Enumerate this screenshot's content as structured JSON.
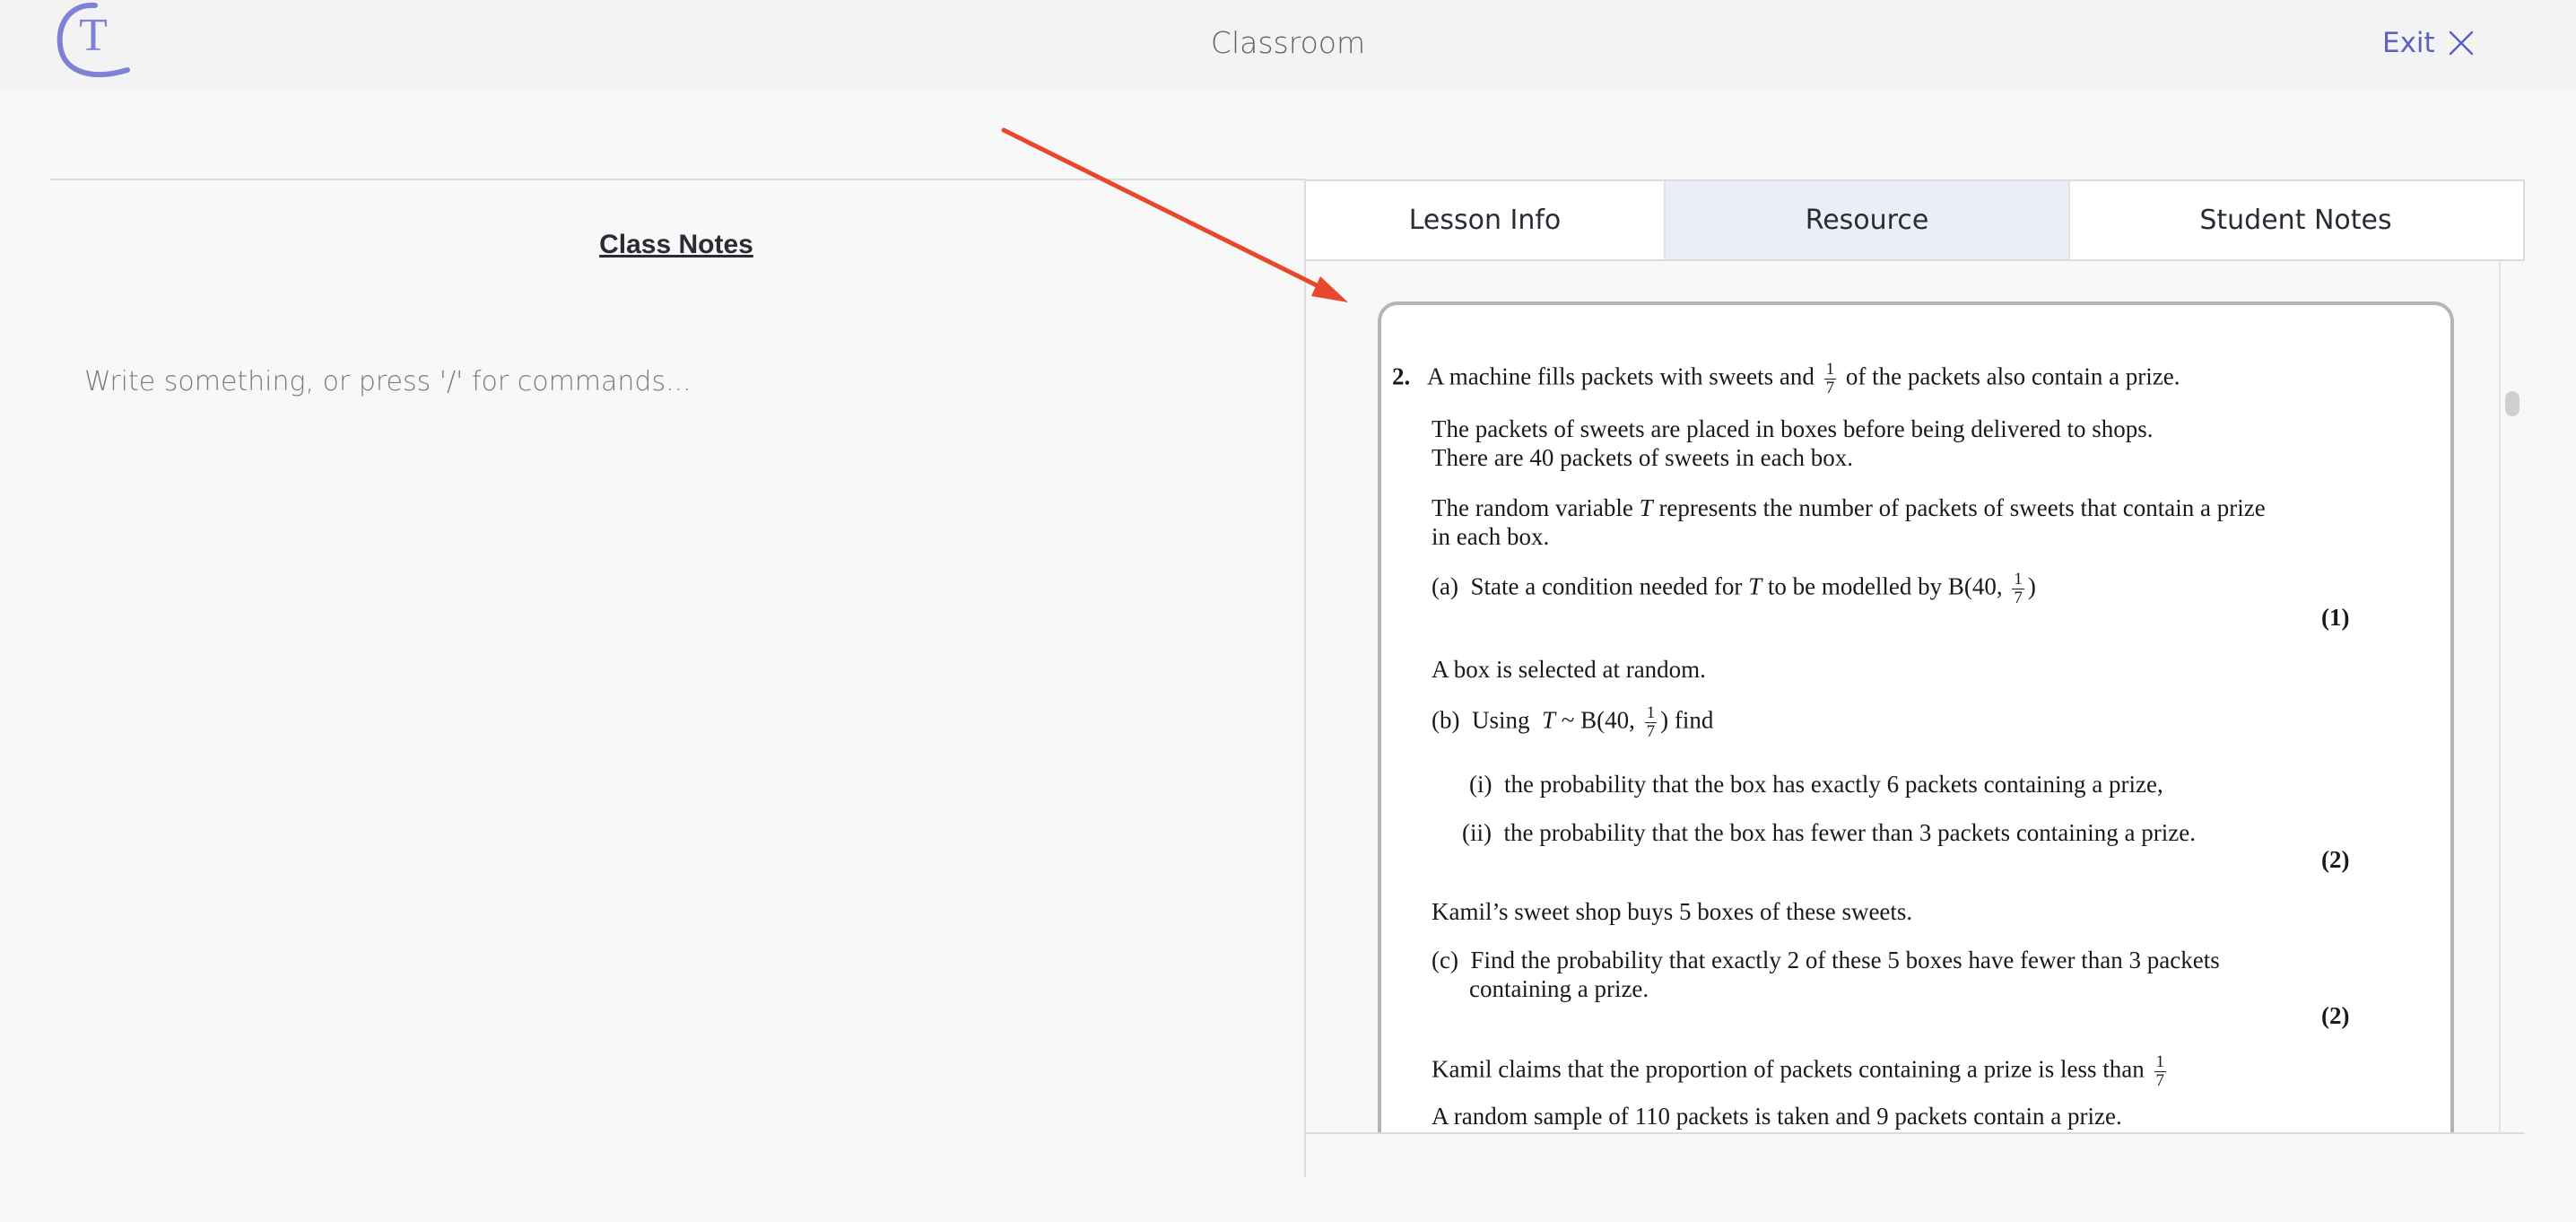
{
  "header": {
    "title": "Classroom",
    "exit_label": "Exit",
    "logo_letter": "T"
  },
  "left_pane": {
    "heading": "Class Notes",
    "editor_placeholder": "Write something, or press '/' for commands..."
  },
  "tabs": [
    {
      "label": "Lesson Info",
      "active": false
    },
    {
      "label": "Resource",
      "active": true
    },
    {
      "label": "Student Notes",
      "active": false
    }
  ],
  "resource": {
    "question_number": "2.",
    "fraction": {
      "numerator": "1",
      "denominator": "7"
    },
    "intro": {
      "before_frac": "A machine fills packets with sweets and",
      "after_frac": "of the packets also contain a prize."
    },
    "para2_line1": "The packets of sweets are placed in boxes before being delivered to shops.",
    "para2_line2": "There are 40 packets of sweets in each box.",
    "para3_pre": "The random variable",
    "var_T": "T",
    "para3_post": "represents the number of packets of sweets that contain a prize",
    "para3_line2": "in each box.",
    "part_a": {
      "label": "(a)",
      "pre": "State a condition needed for",
      "mid": "to be modelled by B(40,",
      "close": ")",
      "marks": "(1)"
    },
    "box_selected": "A box is selected at random.",
    "part_b": {
      "label": "(b)",
      "pre": "Using",
      "mid": "~ B(40,",
      "post": ") find",
      "i_label": "(i)",
      "i_text": "the probability that the box has exactly 6 packets containing a prize,",
      "ii_label": "(ii)",
      "ii_text": "the probability that the box has fewer than 3 packets containing a prize.",
      "marks": "(2)"
    },
    "shop": "Kamil’s sweet shop buys 5 boxes of these sweets.",
    "part_c": {
      "label": "(c)",
      "line1": "Find the probability that exactly 2 of these 5 boxes have fewer than 3 packets",
      "line2": "containing a prize.",
      "marks": "(2)"
    },
    "claim": "Kamil claims that the proportion of packets containing a prize is less than",
    "sample": "A random sample of 110 packets is taken and 9 packets contain a prize."
  },
  "colors": {
    "accent": "#5c62c4",
    "arrow": "#e8472b",
    "active_tab": "#ebeef6"
  },
  "icons": [
    "logo-icon",
    "close-icon",
    "annotation-arrow"
  ]
}
